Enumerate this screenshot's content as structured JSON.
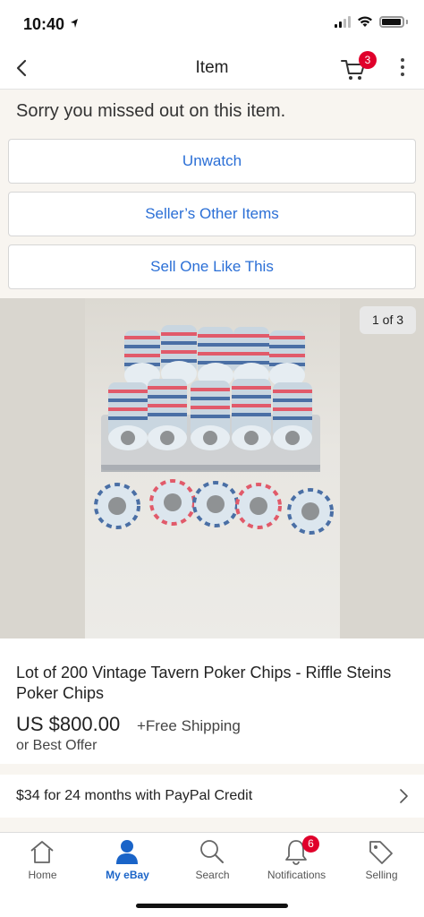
{
  "status_bar": {
    "time": "10:40"
  },
  "header": {
    "title": "Item",
    "cart_count": "3"
  },
  "missed_message": "Sorry you missed out on this item.",
  "actions": {
    "unwatch": "Unwatch",
    "sellers_other_items": "Seller’s Other Items",
    "sell_one_like_this": "Sell One Like This"
  },
  "gallery": {
    "counter": "1 of 3"
  },
  "item": {
    "title": "Lot of 200 Vintage Tavern Poker Chips - Riffle Steins Poker Chips",
    "price": "US $800.00",
    "shipping": "+Free Shipping",
    "best_offer": "or Best Offer"
  },
  "paypal": {
    "text": "$34 for 24 months with PayPal Credit"
  },
  "tabs": [
    {
      "label": "Home",
      "icon": "home-icon"
    },
    {
      "label": "My eBay",
      "icon": "person-icon"
    },
    {
      "label": "Search",
      "icon": "search-icon"
    },
    {
      "label": "Notifications",
      "icon": "bell-icon",
      "badge": "6"
    },
    {
      "label": "Selling",
      "icon": "tag-icon"
    }
  ],
  "colors": {
    "link_blue": "#2b6fd6",
    "badge_red": "#e0002b",
    "active_tab": "#1a64c8"
  }
}
